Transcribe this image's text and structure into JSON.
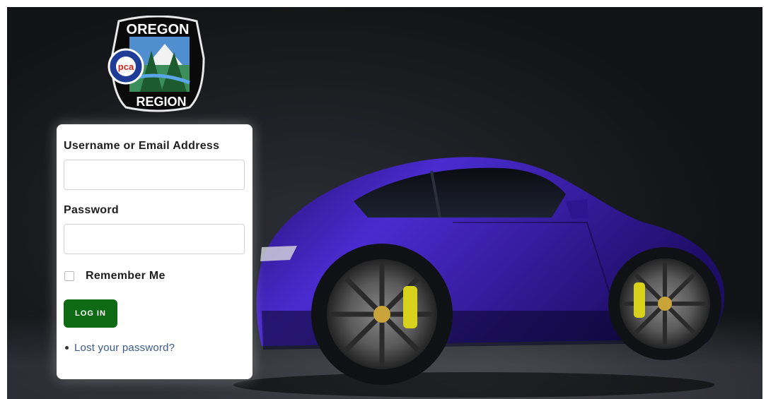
{
  "logo": {
    "top_text": "OREGON",
    "bottom_text": "REGION",
    "badge_text": "pca"
  },
  "form": {
    "username_label": "Username or Email Address",
    "username_value": "",
    "password_label": "Password",
    "password_value": "",
    "remember_label": "Remember Me",
    "remember_checked": false,
    "login_button_label": "LOG IN",
    "lost_password_link": "Lost your password?"
  },
  "colors": {
    "login_button": "#0e6a14",
    "link": "#3b5a8a",
    "car_body": "#3a1fa8"
  },
  "background": {
    "subject": "porsche-911-purple-icon"
  }
}
